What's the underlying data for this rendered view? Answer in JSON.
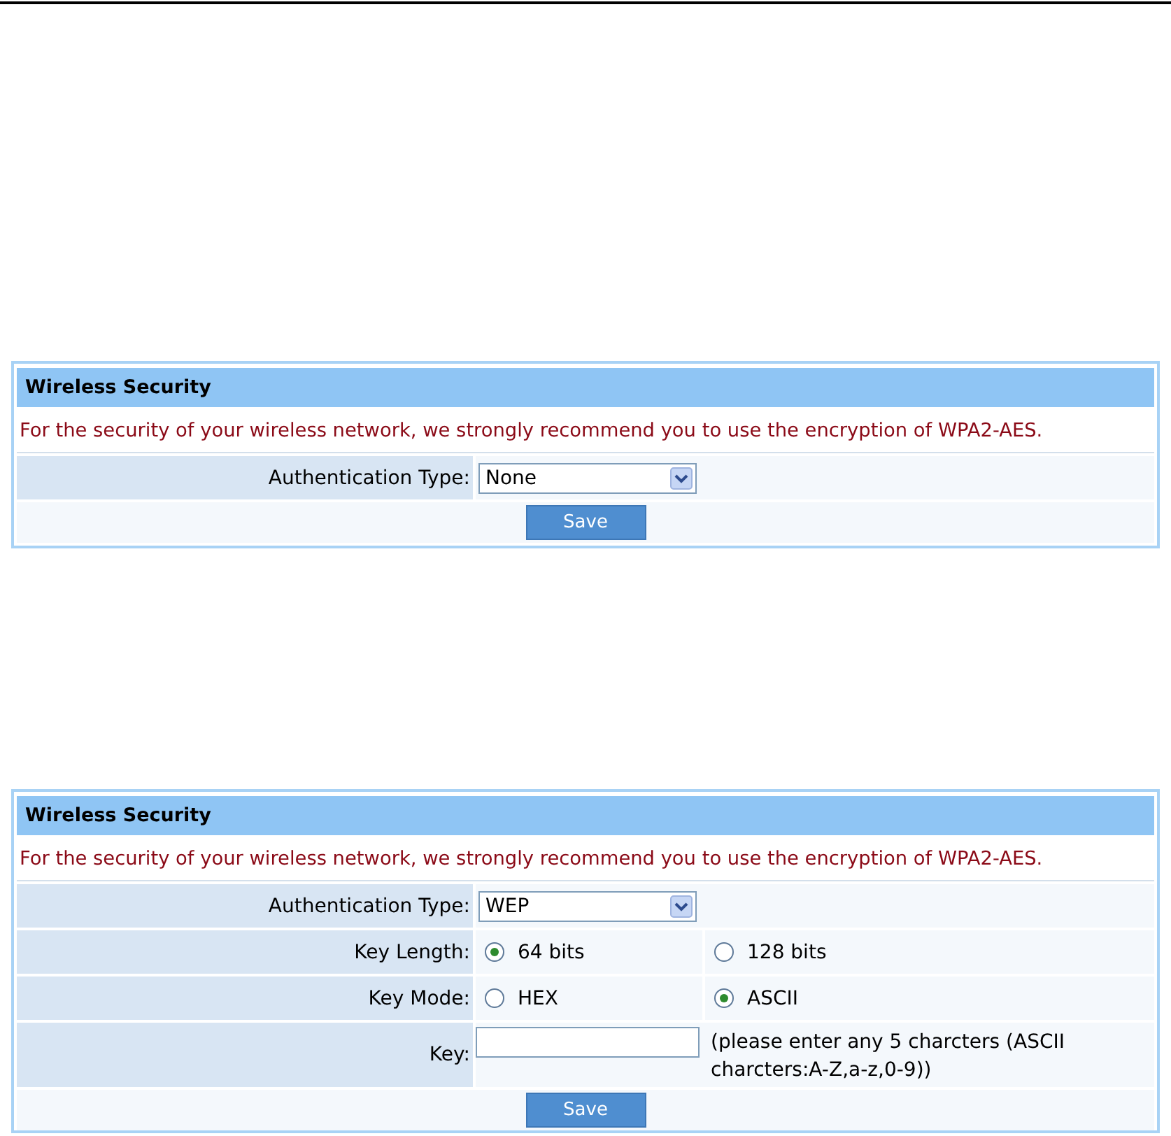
{
  "panels": [
    {
      "title": "Wireless Security",
      "notice": "For the security of your wireless network, we strongly recommend you to use the encryption of WPA2-AES.",
      "rows": [
        {
          "kind": "select",
          "label": "Authentication Type:",
          "value": "None"
        }
      ],
      "button": "Save"
    },
    {
      "title": "Wireless Security",
      "notice": "For the security of your wireless network, we strongly recommend you to use the encryption of WPA2-AES.",
      "rows": [
        {
          "kind": "select",
          "label": "Authentication Type:",
          "value": "WEP"
        },
        {
          "kind": "radio",
          "label": "Key Length:",
          "options": [
            {
              "label": "64 bits",
              "selected": true
            },
            {
              "label": "128 bits",
              "selected": false
            }
          ]
        },
        {
          "kind": "radio",
          "label": "Key Mode:",
          "options": [
            {
              "label": "HEX",
              "selected": false
            },
            {
              "label": "ASCII",
              "selected": true
            }
          ]
        },
        {
          "kind": "input",
          "label": "Key:",
          "hint": "(please enter any 5 charcters (ASCII charcters:A-Z,a-z,0-9))"
        }
      ],
      "button": "Save"
    }
  ]
}
